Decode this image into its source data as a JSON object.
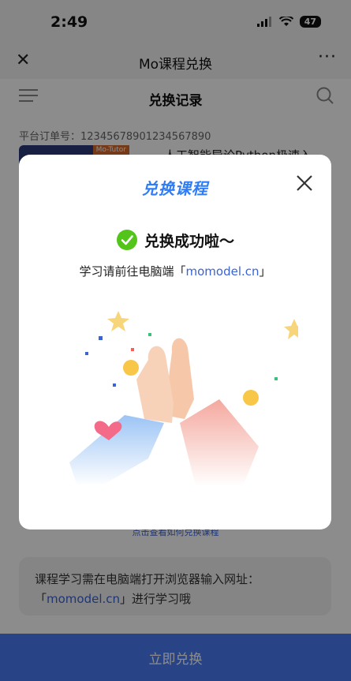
{
  "status_bar": {
    "time": "2:49",
    "battery": "47"
  },
  "nav": {
    "title": "Mo课程兑换",
    "more": "···"
  },
  "page": {
    "title": "兑换记录"
  },
  "order": {
    "label": "平台订单号：12345678901234567890"
  },
  "course": {
    "thumb_tag": "Mo-Tutor",
    "name": "人工智能导论Python极速入"
  },
  "help_link": "点击查看如何兑换课程",
  "hint": {
    "text_before": "课程学习需在电脑端打开浏览器输入网址：「",
    "link": "momodel.cn",
    "text_after": "」进行学习哦"
  },
  "bottom_button": "立即兑换",
  "modal": {
    "title": "兑换课程",
    "success": "兑换成功啦～",
    "sub_before": "学习请前往电脑端「",
    "sub_link": "momodel.cn",
    "sub_after": "」"
  },
  "colors": {
    "accent": "#4a7cf6",
    "link": "#3a63d6",
    "success": "#52c41a"
  }
}
